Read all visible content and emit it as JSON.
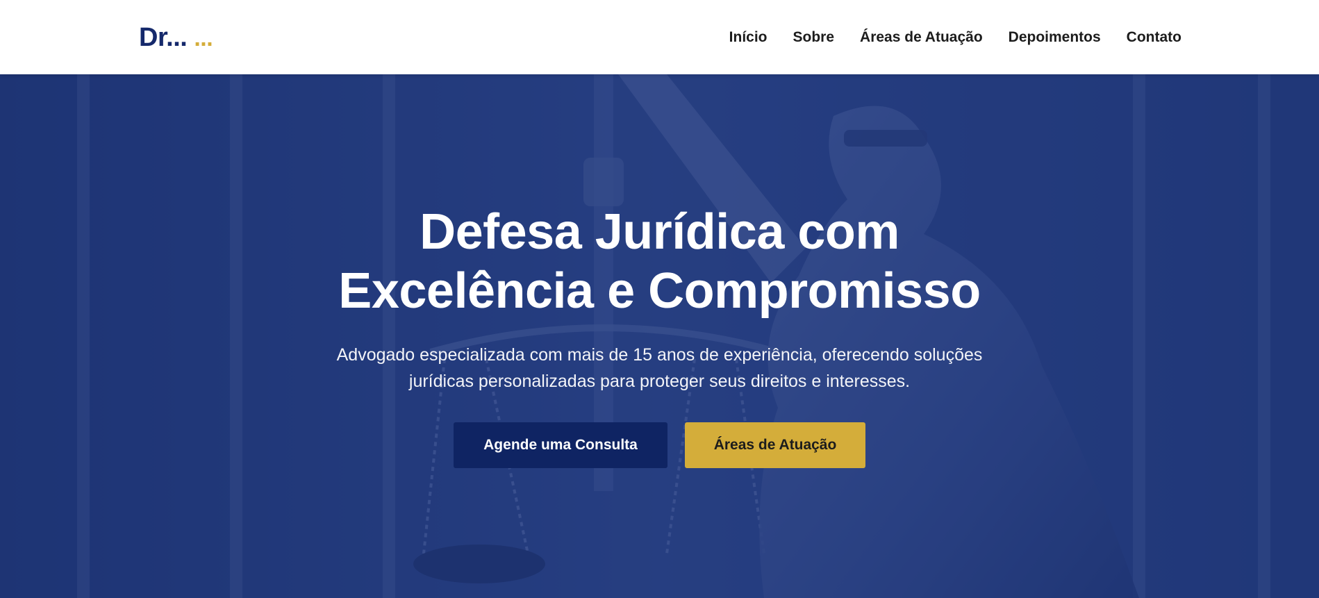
{
  "brand": {
    "logo_main": "Dr...",
    "logo_accent": "..."
  },
  "nav": {
    "links": [
      {
        "label": "Início"
      },
      {
        "label": "Sobre"
      },
      {
        "label": "Áreas de Atuação"
      },
      {
        "label": "Depoimentos"
      },
      {
        "label": "Contato"
      }
    ]
  },
  "hero": {
    "title_line1": "Defesa Jurídica com",
    "title_line2": "Excelência e Compromisso",
    "subtitle_line1": "Advogado especializada com mais de 15 anos de experiência, oferecendo soluções",
    "subtitle_line2": "jurídicas personalizadas para proteger seus direitos e interesses.",
    "primary_button": "Agende uma Consulta",
    "secondary_button": "Áreas de Atuação",
    "background_image": "lady-justice-statue-with-scales"
  },
  "colors": {
    "brand_navy": "#15296b",
    "accent_gold": "#d4ad3a",
    "hero_overlay": "#2c4180",
    "primary_button_bg": "#0f2463"
  }
}
